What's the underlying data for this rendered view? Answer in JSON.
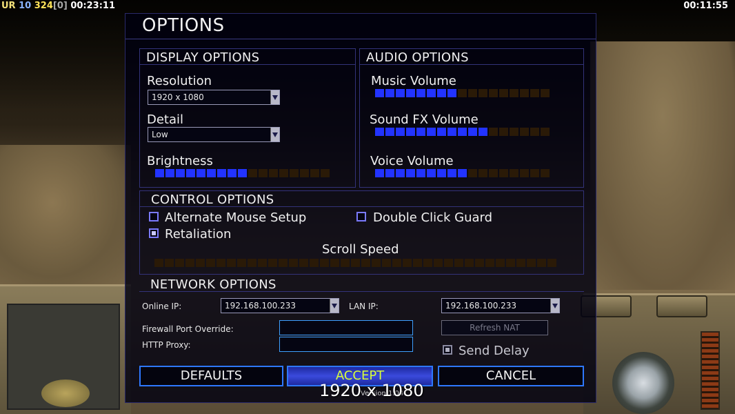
{
  "hud": {
    "faction": "UR",
    "count": "10",
    "money": "324",
    "bracket": "[0]",
    "time_left": "00:23:11",
    "time_right": "00:11:55"
  },
  "dialog": {
    "title": "OPTIONS",
    "display": {
      "title": "DISPLAY OPTIONS",
      "resolution_label": "Resolution",
      "resolution_value": "1920 x 1080",
      "detail_label": "Detail",
      "detail_value": "Low",
      "brightness_label": "Brightness",
      "brightness_level": 9,
      "brightness_segments": 17
    },
    "audio": {
      "title": "AUDIO OPTIONS",
      "music_label": "Music Volume",
      "music_level": 8,
      "sfx_label": "Sound FX Volume",
      "sfx_level": 11,
      "voice_label": "Voice Volume",
      "voice_level": 9,
      "segments": 17
    },
    "control": {
      "title": "CONTROL OPTIONS",
      "alt_mouse_label": "Alternate Mouse Setup",
      "alt_mouse_checked": false,
      "double_click_label": "Double Click Guard",
      "double_click_checked": false,
      "retaliation_label": "Retaliation",
      "retaliation_checked": true,
      "scroll_label": "Scroll Speed",
      "scroll_level": 0,
      "scroll_segments": 39
    },
    "network": {
      "title": "NETWORK OPTIONS",
      "online_ip_label": "Online IP:",
      "online_ip_value": "192.168.100.233",
      "lan_ip_label": "LAN IP:",
      "lan_ip_value": "192.168.100.233",
      "firewall_label": "Firewall Port Override:",
      "firewall_value": "",
      "proxy_label": "HTTP Proxy:",
      "proxy_value": "",
      "refresh_label": "Refresh NAT",
      "send_delay_label": "Send Delay",
      "send_delay_checked": true
    },
    "buttons": {
      "defaults": "DEFAULTS",
      "accept": "ACCEPT",
      "cancel": "CANCEL"
    },
    "version": "Version 1.04"
  },
  "overlay_resolution": "1920 x 1080",
  "colors": {
    "slider_on": "#2233ff",
    "slider_off": "#2a1a07",
    "border_blue": "#2e78ff",
    "accept_text": "#d8ff3a"
  }
}
